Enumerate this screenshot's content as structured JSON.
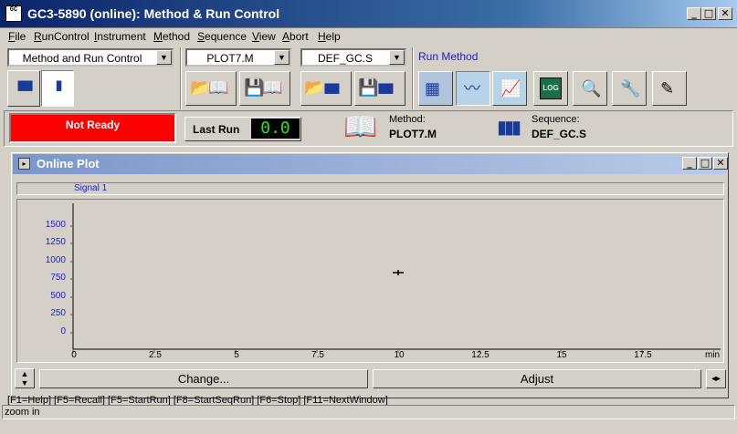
{
  "window": {
    "title": "GC3-5890 (online): Method & Run Control",
    "icon_text": "GC",
    "controls": {
      "minimize": "_",
      "maximize": "□",
      "close": "✕"
    }
  },
  "menu": [
    "File",
    "RunControl",
    "Instrument",
    "Method",
    "Sequence",
    "View",
    "Abort",
    "Help"
  ],
  "toolbar": {
    "view_combo": "Method and Run Control",
    "method_combo": "PLOT7.M",
    "sequence_combo": "DEF_GC.S",
    "run_method_label": "Run Method"
  },
  "status": {
    "state": "Not Ready",
    "last_run_label": "Last Run",
    "last_run_value": "0.0",
    "method_label": "Method:",
    "method_value": "PLOT7.M",
    "sequence_label": "Sequence:",
    "sequence_value": "DEF_GC.S"
  },
  "plot": {
    "title": "Online Plot",
    "signal_label": "Signal 1",
    "y_ticks": [
      "1500",
      "1250",
      "1000",
      "750",
      "500",
      "250",
      "0"
    ],
    "x_ticks": [
      "0",
      "2.5",
      "5",
      "7.5",
      "10",
      "12.5",
      "15",
      "17.5"
    ],
    "x_unit": "min",
    "change_button": "Change...",
    "adjust_button": "Adjust"
  },
  "statusbar": {
    "hotkeys": "[F1=Help] [F5=Recall] [F5=StartRun] [F8=StartSeqRun] [F6=Stop] [F11=NextWindow]",
    "message": "zoom in"
  }
}
